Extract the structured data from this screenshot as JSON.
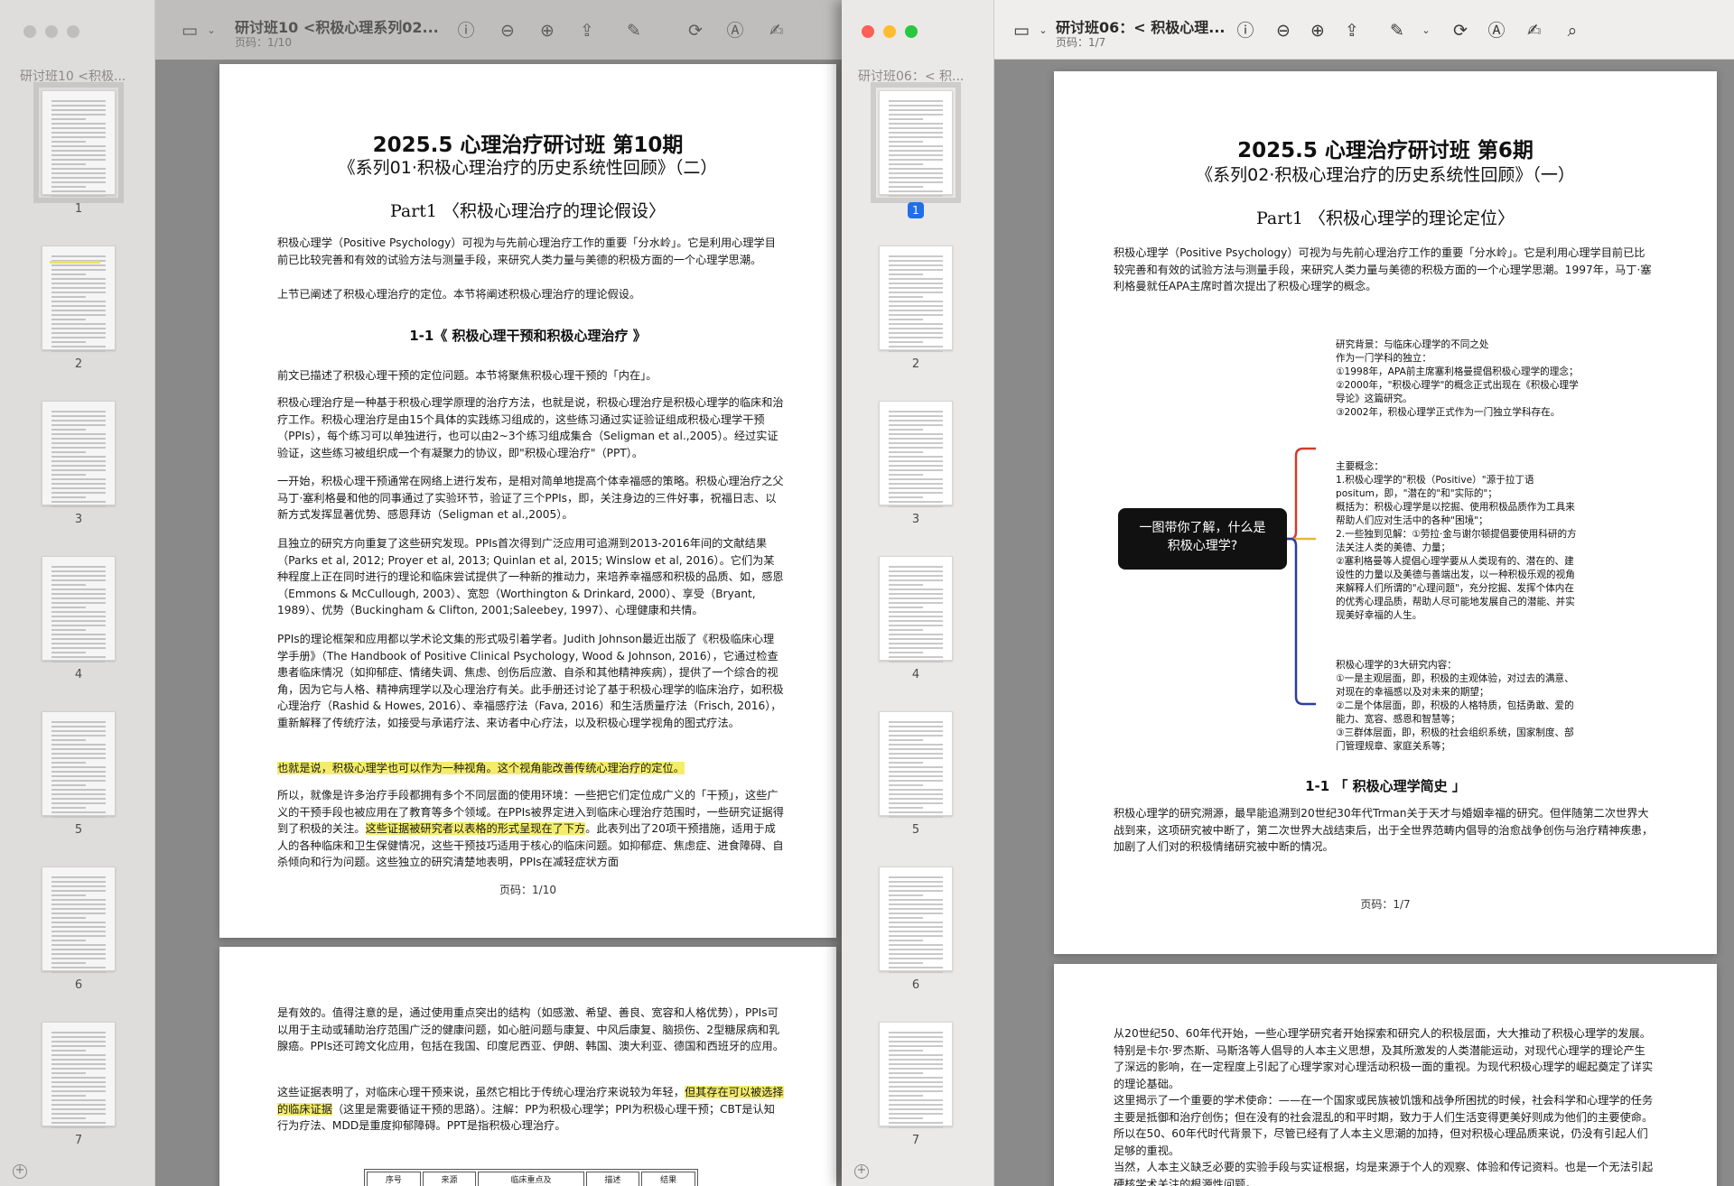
{
  "window1": {
    "title": "研讨班10 <积极心理系列02...",
    "page_indicator": "页码：1/10",
    "sidebar_title": "研讨班10 <积极...",
    "thumb_numbers": [
      "1",
      "2",
      "3",
      "4",
      "5",
      "6",
      "7"
    ],
    "page1": {
      "title": "2025.5 心理治疗研讨班 第10期",
      "subtitle": "《系列01·积极心理治疗的历史系统性回顾》（二）",
      "part": "Part1 〈积极心理治疗的理论假设〉",
      "intro": "积极心理学（Positive Psychology）可视为与先前心理治疗工作的重要「分水岭」。它是利用心理学目前已比较完善和有效的试验方法与测量手段，来研究人类力量与美德的积极方面的一个心理学思潮。",
      "intro2": "上节已阐述了积极心理治疗的定位。本节将阐述积极心理治疗的理论假设。",
      "section": "1-1《 积极心理干预和积极心理治疗 》",
      "p1": "前文已描述了积极心理干预的定位问题。本节将聚焦积极心理干预的「内在」。",
      "p2": "积极心理治疗是一种基于积极心理学原理的治疗方法，也就是说，积极心理治疗是积极心理学的临床和治疗工作。积极心理治疗是由15个具体的实践练习组成的，这些练习通过实证验证组成积极心理学干预（PPIs），每个练习可以单独进行，也可以由2~3个练习组成集合（Seligman et al.,2005）。经过实证验证，这些练习被组织成一个有凝聚力的协议，即\"积极心理治疗\"（PPT）。",
      "p3": "一开始，积极心理干预通常在网络上进行发布，是相对简单地提高个体幸福感的策略。积极心理治疗之父马丁·塞利格曼和他的同事通过了实验环节，验证了三个PPIs，即，关注身边的三件好事，祝福日志、以新方式发挥显著优势、感恩拜访（Seligman et al.,2005）。",
      "p4": "且独立的研究方向重复了这些研究发现。PPIs首次得到广泛应用可追溯到2013-2016年间的文献结果（Parks et al, 2012; Proyer et al, 2013; Quinlan et al, 2015; Winslow et al, 2016）。它们为某种程度上正在同时进行的理论和临床尝试提供了一种新的推动力，来培养幸福感和积极的品质、如，感恩（Emmons & McCullough, 2003）、宽恕（Worthington & Drinkard, 2000）、享受（Bryant, 1989）、优势（Buckingham & Clifton, 2001;Saleebey, 1997）、心理健康和共情。",
      "p5": "PPIs的理论框架和应用都以学术论文集的形式吸引着学者。Judith Johnson最近出版了《积极临床心理学手册》（The Handbook of Positive Clinical Psychology, Wood & Johnson, 2016），它通过检查患者临床情况（如抑郁症、情绪失调、焦虑、创伤后应激、自杀和其他精神疾病），提供了一个综合的视角，因为它与人格、精神病理学以及心理治疗有关。此手册还讨论了基于积极心理学的临床治疗，如积极心理治疗（Rashid & Howes, 2016）、幸福感疗法（Fava, 2016）和生活质量疗法（Frisch, 2016），重新解释了传统疗法，如接受与承诺疗法、来访者中心疗法，以及积极心理学视角的图式疗法。",
      "p6": "也就是说，积极心理学也可以作为一种视角。这个视角能改善传统心理治疗的定位。",
      "p7a": "所以，就像是许多治疗手段都拥有多个不同层面的使用环境：一些把它们定位成广义的「干预」，这些广义的干预手段也被应用在了教育等多个领域。在PPIs被界定进入到临床心理治疗范围时，一些研究证据得到了积极的关注。",
      "p7hl": "这些证据被研究者以表格的形式呈现在了下方",
      "p7b": "。此表列出了20项干预措施，适用于成人的各种临床和卫生保健情况，这些干预技巧适用于核心的临床问题。如抑郁症、焦虑症、进食障碍、自杀倾向和行为问题。这些独立的研究清楚地表明，PPIs在减轻症状方面",
      "footer": "页码：1/10"
    },
    "page2": {
      "p1": "是有效的。值得注意的是，通过使用重点突出的结构（如感激、希望、善良、宽容和人格优势），PPIs可以用于主动或辅助治疗范围广泛的健康问题，如心脏问题与康复、中风后康复、脑损伤、2型糖尿病和乳腺癌。PPIs还可跨文化应用，包括在我国、印度尼西亚、伊朗、韩国、澳大利亚、德国和西班牙的应用。",
      "p2a": "这些证据表明了，对临床心理干预来说，虽然它相比于传统心理治疗来说较为年轻，",
      "p2hl": "但其存在可以被选择的临床证据",
      "p2b": "（这里是需要循证干预的思路）。注解：PP为积极心理学；PPI为积极心理干预；CBT是认知行为疗法、MDD是重度抑郁障碍。PPT是指积极心理治疗。",
      "table_headers": [
        "序号",
        "来源",
        "临床重点及",
        "描述",
        "结果"
      ]
    }
  },
  "window2": {
    "title": "研讨班06：< 积极心理...",
    "page_indicator": "页码：1/7",
    "sidebar_title": "研讨班06：< 积...",
    "thumb_numbers": [
      "1",
      "2",
      "3",
      "4",
      "5",
      "6",
      "7"
    ],
    "page1": {
      "title": "2025.5 心理治疗研讨班 第6期",
      "subtitle": "《系列02·积极心理治疗的历史系统性回顾》（一）",
      "part": "Part1 〈积极心理学的理论定位〉",
      "intro": "积极心理学（Positive Psychology）可视为与先前心理治疗工作的重要「分水岭」。它是利用心理学目前已比较完善和有效的试验方法与测量手段，来研究人类力量与美德的积极方面的一个心理学思潮。1997年，马丁·塞利格曼就任APA主席时首次提出了积极心理学的概念。",
      "mindmap_center": "一图带你了解，什么是积极心理学?",
      "mm1": [
        "研究背景：与临床心理学的不同之处",
        "作为一门学科的独立：",
        "①1998年，APA前主席塞利格曼提倡积极心理学的理念；",
        "②2000年，\"积极心理学\"的概念正式出现在《积极心理学导论》这篇研究。",
        "③2002年，积极心理学正式作为一门独立学科存在。"
      ],
      "mm2": [
        "主要概念：",
        "1.积极心理学的\"积极（Positive）\"源于拉丁语positum，即，\"潜在的\"和\"实际的\"；",
        "概括为：积极心理学是以挖掘、使用积极品质作为工具来帮助人们应对生活中的各种\"困境\"；",
        "2.一些独到见解：①劳拉·金与谢尔顿提倡要使用科研的方法关注人类的美德、力量；",
        "②塞利格曼等人提倡心理学要从人类现有的、潜在的、建设性的力量以及美德与善端出发，以一种积极乐观的视角来解释人们所谓的\"心理问题\"，充分挖掘、发挥个体内在的优秀心理品质，帮助人尽可能地发展自己的潜能、并实现美好幸福的人生。"
      ],
      "mm3": [
        "积极心理学的3大研究内容：",
        "①一是主观层面，即，积极的主观体验，对过去的满意、对现在的幸福感以及对未来的期望；",
        "②二是个体层面，即，积极的人格特质，包括勇敢、爱的能力、宽容、感恩和智慧等；",
        "③三群体层面，即，积极的社会组织系统，国家制度、部门管理规章、家庭关系等；"
      ],
      "section": "1-1 「 积极心理学简史 」",
      "p1": "积极心理学的研究溯源，最早能追溯到20世纪30年代Trman关于天才与婚姻幸福的研究。但伴随第二次世界大战到来，这项研究被中断了，第二次世界大战结束后，出于全世界范畴内倡导的治愈战争创伤与治疗精神疾患，加剧了人们对的积极情绪研究被中断的情况。",
      "footer": "页码：1/7"
    },
    "page2": {
      "p1": "从20世纪50、60年代开始，一些心理学研究者开始探索和研究人的积极层面，大大推动了积极心理学的发展。特别是卡尔·罗杰斯、马斯洛等人倡导的人本主义思想，及其所激发的人类潜能运动，对现代心理学的理论产生了深远的影响，在一定程度上引起了心理学家对心理活动积极一面的重视。为现代积极心理学的崛起奠定了详实的理论基础。",
      "p2": "这里揭示了一个重要的学术使命：——在一个国家或民族被饥饿和战争所困扰的时候，社会科学和心理学的任务主要是抵御和治疗创伤；但在没有的社会混乱的和平时期，致力于人们生活变得更美好则成为他们的主要使命。所以在50、60年代时代背景下，尽管已经有了人本主义思潮的加持，但对积极心理品质来说，仍没有引起人们足够的重视。",
      "p3": "当然，人本主义缺乏必要的实验手段与实证根据，均是来源于个人的观察、体验和传记资料。也是一个无法引起硬核学术关注的根源性问题。"
    }
  },
  "colors": {
    "highlight": "#f4ed6b",
    "selected": "#1f6feb",
    "mm_red": "#d23b2f",
    "mm_yellow": "#e6b73a",
    "mm_blue": "#2c3f9f"
  }
}
